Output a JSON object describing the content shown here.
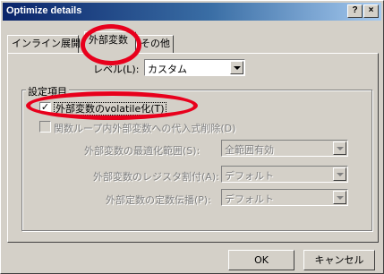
{
  "window": {
    "title": "Optimize details",
    "help_label": "?",
    "close_label": "×"
  },
  "tabs": [
    {
      "label": "インライン展開"
    },
    {
      "label": "外部変数"
    },
    {
      "label": "その他"
    }
  ],
  "level": {
    "label": "レベル(L):",
    "value": "カスタム"
  },
  "group": {
    "title": "設定項目",
    "volatile_label": "外部変数のvolatile化(T)",
    "volatile_check": "✓",
    "assign_label": "関数ループ内外部変数への代入式削除(D)",
    "range_label": "外部変数の最適化範囲(S):",
    "range_value": "全範囲有効",
    "register_label": "外部変数のレジスタ割付(A):",
    "register_value": "デフォルト",
    "const_label": "外部定数の定数伝播(P):",
    "const_value": "デフォルト"
  },
  "buttons": {
    "ok": "OK",
    "cancel": "キャンセル"
  },
  "colors": {
    "highlight": "#e8001c",
    "titlebar_start": "#0a246a",
    "face": "#d4d0c8"
  }
}
